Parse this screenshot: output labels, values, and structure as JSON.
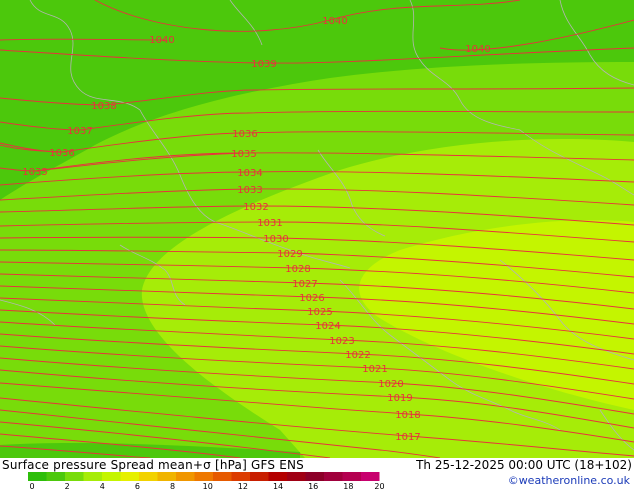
{
  "title": "Surface pressure Spread mean+σ [hPa] GFS ENS",
  "date": "Th 25-12-2025 00:00 UTC (18+102)",
  "credit": "©weatheronline.co.uk",
  "colors": {
    "zone_dark": "#4cc80c",
    "zone_mid": "#78dc0a",
    "zone_light": "#a6ec08",
    "zone_lightest": "#c4f500",
    "isobar": "#e8323c",
    "coast": "#b4b4b4"
  },
  "colorbar": {
    "ticks": [
      "0",
      "2",
      "4",
      "6",
      "8",
      "10",
      "12",
      "14",
      "16",
      "18",
      "20"
    ],
    "colors": [
      "#2dbe0a",
      "#4cc80c",
      "#78dc0a",
      "#a6ec08",
      "#c4f500",
      "#e6f000",
      "#f2d200",
      "#f0b400",
      "#f09600",
      "#ee7800",
      "#e65a00",
      "#dc3c00",
      "#c81e00",
      "#b40000",
      "#a00014",
      "#8c0028",
      "#a0003c",
      "#b40050",
      "#c8006e"
    ]
  },
  "isobars": [
    {
      "value": "1040",
      "label": "1040"
    },
    {
      "value": "1039",
      "label": "1039"
    },
    {
      "value": "1038",
      "label": "1038"
    },
    {
      "value": "1037",
      "label": "1037"
    },
    {
      "value": "1036",
      "label": "1036"
    },
    {
      "value": "1035",
      "label": "1035"
    },
    {
      "value": "1034",
      "label": "1034"
    },
    {
      "value": "1033",
      "label": "1033"
    },
    {
      "value": "1032",
      "label": "1032"
    },
    {
      "value": "1031",
      "label": "1031"
    },
    {
      "value": "1030",
      "label": "1030"
    },
    {
      "value": "1029",
      "label": "1029"
    },
    {
      "value": "1028",
      "label": "1028"
    },
    {
      "value": "1027",
      "label": "1027"
    },
    {
      "value": "1026",
      "label": "1026"
    },
    {
      "value": "1025",
      "label": "1025"
    },
    {
      "value": "1024",
      "label": "1024"
    },
    {
      "value": "1023",
      "label": "1023"
    },
    {
      "value": "1022",
      "label": "1022"
    },
    {
      "value": "1021",
      "label": "1021"
    },
    {
      "value": "1020",
      "label": "1020"
    },
    {
      "value": "1019",
      "label": "1019"
    },
    {
      "value": "1018",
      "label": "1018"
    },
    {
      "value": "1017",
      "label": "1017"
    }
  ]
}
